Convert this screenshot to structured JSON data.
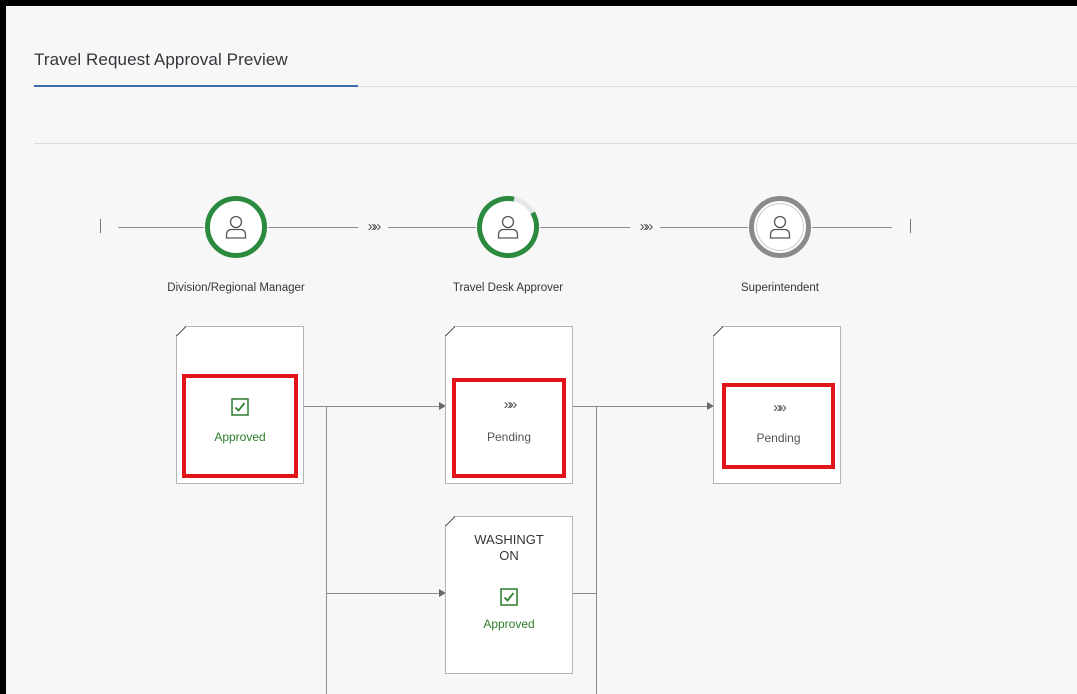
{
  "page": {
    "title": "Travel Request Approval Preview"
  },
  "steps": [
    {
      "label": "Division/Regional Manager",
      "status": "complete",
      "color": "#2b8a3e"
    },
    {
      "label": "Travel Desk Approver",
      "status": "in-progress",
      "color": "#2b8a3e"
    },
    {
      "label": "Superintendent",
      "status": "not-started",
      "color": "#8a8a8a"
    }
  ],
  "flow_separator": "»»",
  "cards": [
    {
      "status_label": "Approved",
      "status": "approved",
      "icon": "checkbox-icon",
      "highlighted": true
    },
    {
      "status_label": "Pending",
      "status": "pending",
      "icon": "chevrons-icon",
      "highlighted": true
    },
    {
      "status_label": "Pending",
      "status": "pending",
      "icon": "chevrons-icon",
      "highlighted": true
    },
    {
      "title": "WASHINGT\nON",
      "title_line1": "WASHINGT",
      "title_line2": "ON",
      "status_label": "Approved",
      "status": "approved",
      "icon": "checkbox-icon",
      "highlighted": false
    }
  ],
  "colors": {
    "accent": "#3b6cb0",
    "approved": "#2b7d2b",
    "highlight": "#e1141a"
  }
}
